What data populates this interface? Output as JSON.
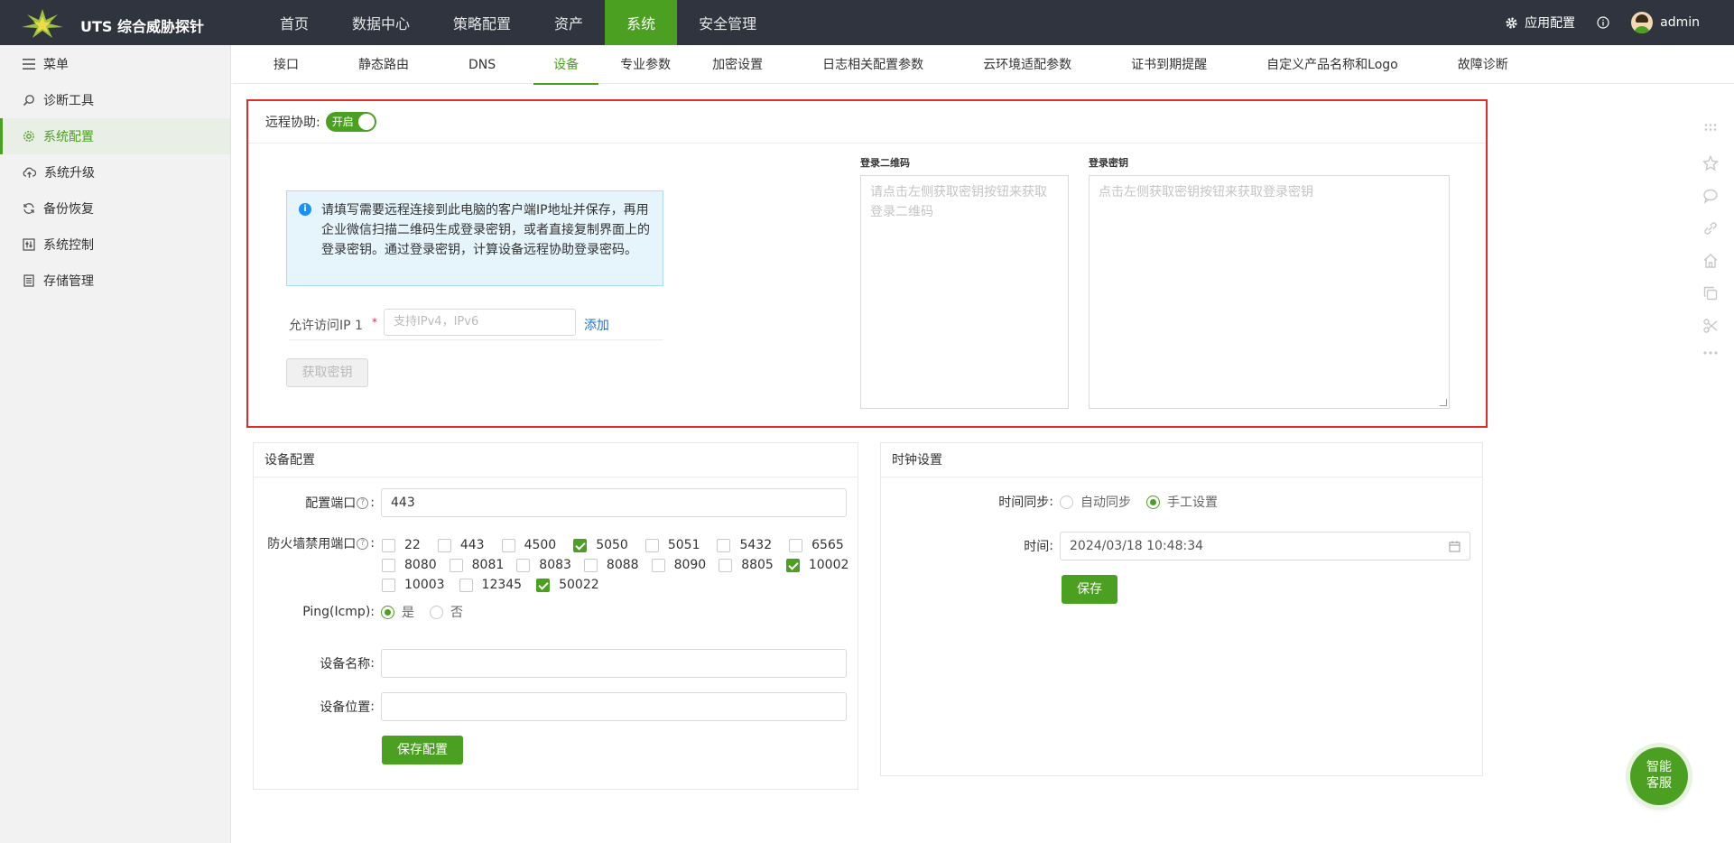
{
  "app": {
    "title": "UTS 综合威胁探针"
  },
  "topnav": [
    {
      "label": "首页",
      "active": false
    },
    {
      "label": "数据中心",
      "active": false
    },
    {
      "label": "策略配置",
      "active": false
    },
    {
      "label": "资产",
      "active": false
    },
    {
      "label": "系统",
      "active": true
    },
    {
      "label": "安全管理",
      "active": false
    }
  ],
  "topright": {
    "app_config": "应用配置",
    "user": "admin"
  },
  "sidebar": {
    "menu_label": "菜单",
    "items": [
      {
        "label": "诊断工具",
        "icon": "search-icon",
        "active": false
      },
      {
        "label": "系统配置",
        "icon": "gear-icon",
        "active": true
      },
      {
        "label": "系统升级",
        "icon": "cloud-upload-icon",
        "active": false
      },
      {
        "label": "备份恢复",
        "icon": "refresh-icon",
        "active": false
      },
      {
        "label": "系统控制",
        "icon": "control-icon",
        "active": false
      },
      {
        "label": "存储管理",
        "icon": "storage-icon",
        "active": false
      }
    ]
  },
  "subtabs": [
    {
      "label": "接口",
      "active": false
    },
    {
      "label": "静态路由",
      "active": false
    },
    {
      "label": "DNS",
      "active": false
    },
    {
      "label": "设备",
      "active": true
    },
    {
      "label": "专业参数",
      "active": false
    },
    {
      "label": "加密设置",
      "active": false
    },
    {
      "label": "日志相关配置参数",
      "active": false
    },
    {
      "label": "云环境适配参数",
      "active": false
    },
    {
      "label": "证书到期提醒",
      "active": false
    },
    {
      "label": "自定义产品名称和Logo",
      "active": false
    },
    {
      "label": "故障诊断",
      "active": false
    }
  ],
  "remote": {
    "label": "远程协助:",
    "switch_label": "开启",
    "notice": "请填写需要远程连接到此电脑的客户端IP地址并保存，再用企业微信扫描二维码生成登录密钥，或者直接复制界面上的登录密钥。通过登录密钥，计算设备远程协助登录密码。",
    "ip_label": "允许访问IP 1",
    "ip_required": "*",
    "ip_placeholder": "支持IPv4，IPv6",
    "add_label": "添加",
    "get_key_label": "获取密钥",
    "qr_label": "登录二维码",
    "qr_placeholder": "请点击左侧获取密钥按钮来获取登录二维码",
    "key_label": "登录密钥",
    "key_placeholder": "点击左侧获取密钥按钮来获取登录密钥"
  },
  "device": {
    "title": "设备配置",
    "port_label": "配置端口",
    "port_value": "443",
    "firewall_label": "防火墙禁用端口",
    "ports": [
      [
        {
          "p": "22",
          "c": false
        },
        {
          "p": "443",
          "c": false
        },
        {
          "p": "4500",
          "c": false
        },
        {
          "p": "5050",
          "c": true
        },
        {
          "p": "5051",
          "c": false
        },
        {
          "p": "5432",
          "c": false
        },
        {
          "p": "6565",
          "c": false
        }
      ],
      [
        {
          "p": "8080",
          "c": false
        },
        {
          "p": "8081",
          "c": false
        },
        {
          "p": "8083",
          "c": false
        },
        {
          "p": "8088",
          "c": false
        },
        {
          "p": "8090",
          "c": false
        },
        {
          "p": "8805",
          "c": false
        },
        {
          "p": "10002",
          "c": true
        }
      ],
      [
        {
          "p": "10003",
          "c": false
        },
        {
          "p": "12345",
          "c": false
        },
        {
          "p": "50022",
          "c": true
        }
      ]
    ],
    "ping_label": "Ping(Icmp)",
    "ping_yes": "是",
    "ping_no": "否",
    "ping_selected": "是",
    "name_label": "设备名称",
    "name_value": "",
    "location_label": "设备位置",
    "location_value": "",
    "save_label": "保存配置"
  },
  "clock": {
    "title": "时钟设置",
    "sync_label": "时间同步",
    "auto_label": "自动同步",
    "manual_label": "手工设置",
    "sync_selected": "手工设置",
    "time_label": "时间",
    "time_value": "2024/03/18 10:48:34",
    "save_label": "保存"
  },
  "float": {
    "ai_line1": "智能",
    "ai_line2": "客服"
  },
  "colors": {
    "accent": "#4b9f21",
    "topbar": "#2f343f",
    "highlight_border": "#e22b2b",
    "link": "#1a73d9"
  }
}
